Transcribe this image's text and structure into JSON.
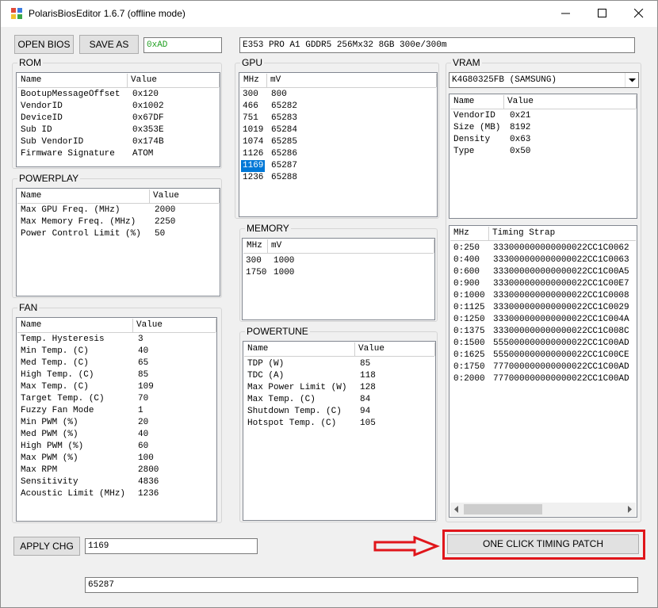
{
  "window": {
    "title": "PolarisBiosEditor 1.6.7 (offline mode)"
  },
  "toolbar": {
    "open_bios_label": "OPEN BIOS",
    "save_as_label": "SAVE AS",
    "checksum_value": "0xAD",
    "bios_info_value": "E353 PRO A1 GDDR5 256Mx32 8GB 300e/300m"
  },
  "rom": {
    "title": "ROM",
    "headers": [
      "Name",
      "Value"
    ],
    "rows": [
      [
        "BootupMessageOffset",
        "0x120"
      ],
      [
        "VendorID",
        "0x1002"
      ],
      [
        "DeviceID",
        "0x67DF"
      ],
      [
        "Sub ID",
        "0x353E"
      ],
      [
        "Sub VendorID",
        "0x174B"
      ],
      [
        "Firmware Signature",
        "ATOM"
      ]
    ]
  },
  "powerplay": {
    "title": "POWERPLAY",
    "headers": [
      "Name",
      "Value"
    ],
    "rows": [
      [
        "Max GPU Freq. (MHz)",
        "2000"
      ],
      [
        "Max Memory Freq. (MHz)",
        "2250"
      ],
      [
        "Power Control Limit (%)",
        "50"
      ]
    ]
  },
  "fan": {
    "title": "FAN",
    "headers": [
      "Name",
      "Value"
    ],
    "rows": [
      [
        "Temp. Hysteresis",
        "3"
      ],
      [
        "Min Temp. (C)",
        "40"
      ],
      [
        "Med Temp. (C)",
        "65"
      ],
      [
        "High Temp. (C)",
        "85"
      ],
      [
        "Max Temp. (C)",
        "109"
      ],
      [
        "Target Temp. (C)",
        "70"
      ],
      [
        "Fuzzy Fan Mode",
        "1"
      ],
      [
        "Min PWM (%)",
        "20"
      ],
      [
        "Med PWM (%)",
        "40"
      ],
      [
        "High PWM (%)",
        "60"
      ],
      [
        "Max PWM (%)",
        "100"
      ],
      [
        "Max RPM",
        "2800"
      ],
      [
        "Sensitivity",
        "4836"
      ],
      [
        "Acoustic Limit (MHz)",
        "1236"
      ]
    ]
  },
  "gpu": {
    "title": "GPU",
    "headers": [
      "MHz",
      "mV"
    ],
    "rows": [
      [
        "300",
        "800"
      ],
      [
        "466",
        "65282"
      ],
      [
        "751",
        "65283"
      ],
      [
        "1019",
        "65284"
      ],
      [
        "1074",
        "65285"
      ],
      [
        "1126",
        "65286"
      ],
      [
        "1169",
        "65287"
      ],
      [
        "1236",
        "65288"
      ]
    ],
    "selected_index": 6
  },
  "memory": {
    "title": "MEMORY",
    "headers": [
      "MHz",
      "mV"
    ],
    "rows": [
      [
        "300",
        "1000"
      ],
      [
        "1750",
        "1000"
      ]
    ]
  },
  "powertune": {
    "title": "POWERTUNE",
    "headers": [
      "Name",
      "Value"
    ],
    "rows": [
      [
        "TDP (W)",
        "85"
      ],
      [
        "TDC (A)",
        "118"
      ],
      [
        "Max Power Limit (W)",
        "128"
      ],
      [
        "Max Temp. (C)",
        "84"
      ],
      [
        "Shutdown Temp. (C)",
        "94"
      ],
      [
        "Hotspot Temp. (C)",
        "105"
      ]
    ]
  },
  "vram": {
    "title": "VRAM",
    "selected_chip": "K4G80325FB (SAMSUNG)",
    "headers": [
      "Name",
      "Value"
    ],
    "rows": [
      [
        "VendorID",
        "0x21"
      ],
      [
        "Size (MB)",
        "8192"
      ],
      [
        "Density",
        "0x63"
      ],
      [
        "Type",
        "0x50"
      ]
    ]
  },
  "timing": {
    "headers": [
      "MHz",
      "Timing Strap"
    ],
    "rows": [
      [
        "0:250",
        "333000000000000022CC1C0062"
      ],
      [
        "0:400",
        "333000000000000022CC1C0063"
      ],
      [
        "0:600",
        "333000000000000022CC1C00A5"
      ],
      [
        "0:900",
        "333000000000000022CC1C00E7"
      ],
      [
        "0:1000",
        "333000000000000022CC1C0008"
      ],
      [
        "0:1125",
        "333000000000000022CC1C0029"
      ],
      [
        "0:1250",
        "333000000000000022CC1C004A"
      ],
      [
        "0:1375",
        "333000000000000022CC1C008C"
      ],
      [
        "0:1500",
        "555000000000000022CC1C00AD"
      ],
      [
        "0:1625",
        "555000000000000022CC1C00CE"
      ],
      [
        "0:1750",
        "777000000000000022CC1C00AD"
      ],
      [
        "0:2000",
        "777000000000000022CC1C00AD"
      ]
    ]
  },
  "bottom": {
    "apply_label": "APPLY CHG",
    "edit_value_1": "1169",
    "edit_value_2": "65287",
    "one_click_label": "ONE CLICK TIMING PATCH"
  },
  "annotation": {
    "color": "#e0161b"
  }
}
